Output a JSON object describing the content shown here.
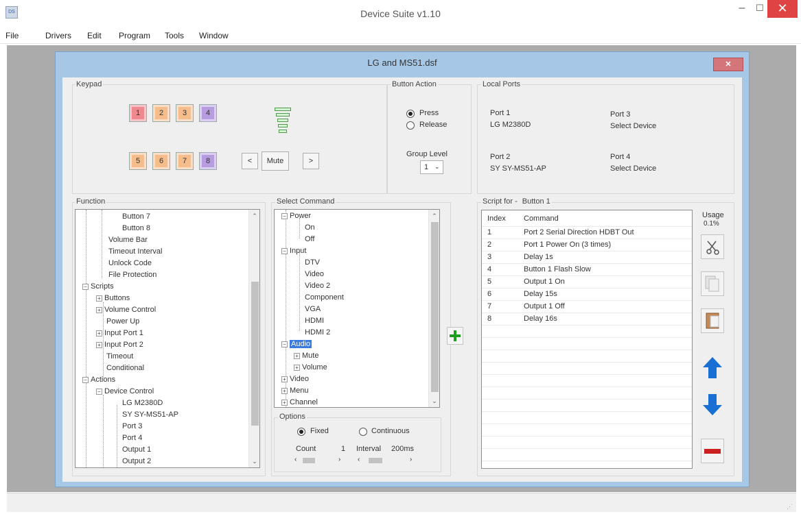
{
  "app": {
    "title": "Device Suite v1.10",
    "icon_text": "DS",
    "min": "–",
    "max": "☐",
    "close": "✕"
  },
  "menu": [
    "File",
    "Drivers",
    "Edit",
    "Program",
    "Tools",
    "Window"
  ],
  "doc": {
    "title": "LG and MS51.dsf",
    "close": "✕"
  },
  "keypad": {
    "label": "Keypad",
    "keys": [
      "1",
      "2",
      "3",
      "4",
      "5",
      "6",
      "7",
      "8"
    ],
    "prev": "<",
    "mute": "Mute",
    "next": ">"
  },
  "button_action": {
    "label": "Button Action",
    "press": "Press",
    "release": "Release",
    "group_level_label": "Group Level",
    "group_level_value": "1"
  },
  "local_ports": {
    "label": "Local Ports",
    "ports": [
      {
        "name": "Port 1",
        "device": "LG M2380D"
      },
      {
        "name": "Port 3",
        "device": "Select Device"
      },
      {
        "name": "Port 2",
        "device": "SY SY-MS51-AP"
      },
      {
        "name": "Port 4",
        "device": "Select Device"
      }
    ]
  },
  "function": {
    "label": "Function",
    "items": [
      "Button 7",
      "Button 8",
      "Volume Bar",
      "Timeout Interval",
      "Unlock Code",
      "File Protection",
      "Scripts",
      "Buttons",
      "Volume Control",
      "Power Up",
      "Input Port 1",
      "Input Port 2",
      "Timeout",
      "Conditional",
      "Actions",
      "Device Control",
      "LG M2380D",
      "SY SY-MS51-AP",
      "Port 3",
      "Port 4",
      "Output 1",
      "Output 2"
    ]
  },
  "select_command": {
    "label": "Select Command",
    "items": [
      "Power",
      "On",
      "Off",
      "Input",
      "DTV",
      "Video",
      "Video 2",
      "Component",
      "VGA",
      "HDMI",
      "HDMI 2",
      "Audio",
      "Mute",
      "Volume",
      "Video",
      "Menu",
      "Channel"
    ]
  },
  "options": {
    "label": "Options",
    "fixed": "Fixed",
    "continuous": "Continuous",
    "count_label": "Count",
    "count_value": "1",
    "interval_label": "Interval",
    "interval_value": "200ms"
  },
  "script": {
    "label": "Script for -",
    "target": "Button 1",
    "col_index": "Index",
    "col_command": "Command",
    "rows": [
      {
        "index": "1",
        "command": "Port 2 Serial Direction HDBT Out"
      },
      {
        "index": "2",
        "command": "Port 1 Power On (3 times)"
      },
      {
        "index": "3",
        "command": "Delay 1s"
      },
      {
        "index": "4",
        "command": "Button 1 Flash Slow"
      },
      {
        "index": "5",
        "command": "Output 1 On"
      },
      {
        "index": "6",
        "command": "Delay 15s"
      },
      {
        "index": "7",
        "command": "Output 1 Off"
      },
      {
        "index": "8",
        "command": "Delay 16s"
      }
    ],
    "usage_label": "Usage",
    "usage_value": "0.1%"
  },
  "colors": {
    "key_red": "#f08890",
    "key_orange": "#f5bd8c",
    "key_purple": "#b89ce0",
    "add_green": "#1e9e1e",
    "arrow_blue": "#1a6fd4",
    "remove_red": "#cc1f1f"
  },
  "icons": [
    "scissors-icon",
    "copy-icon",
    "paste-icon",
    "move-up-icon",
    "move-down-icon",
    "remove-icon",
    "add-icon"
  ]
}
